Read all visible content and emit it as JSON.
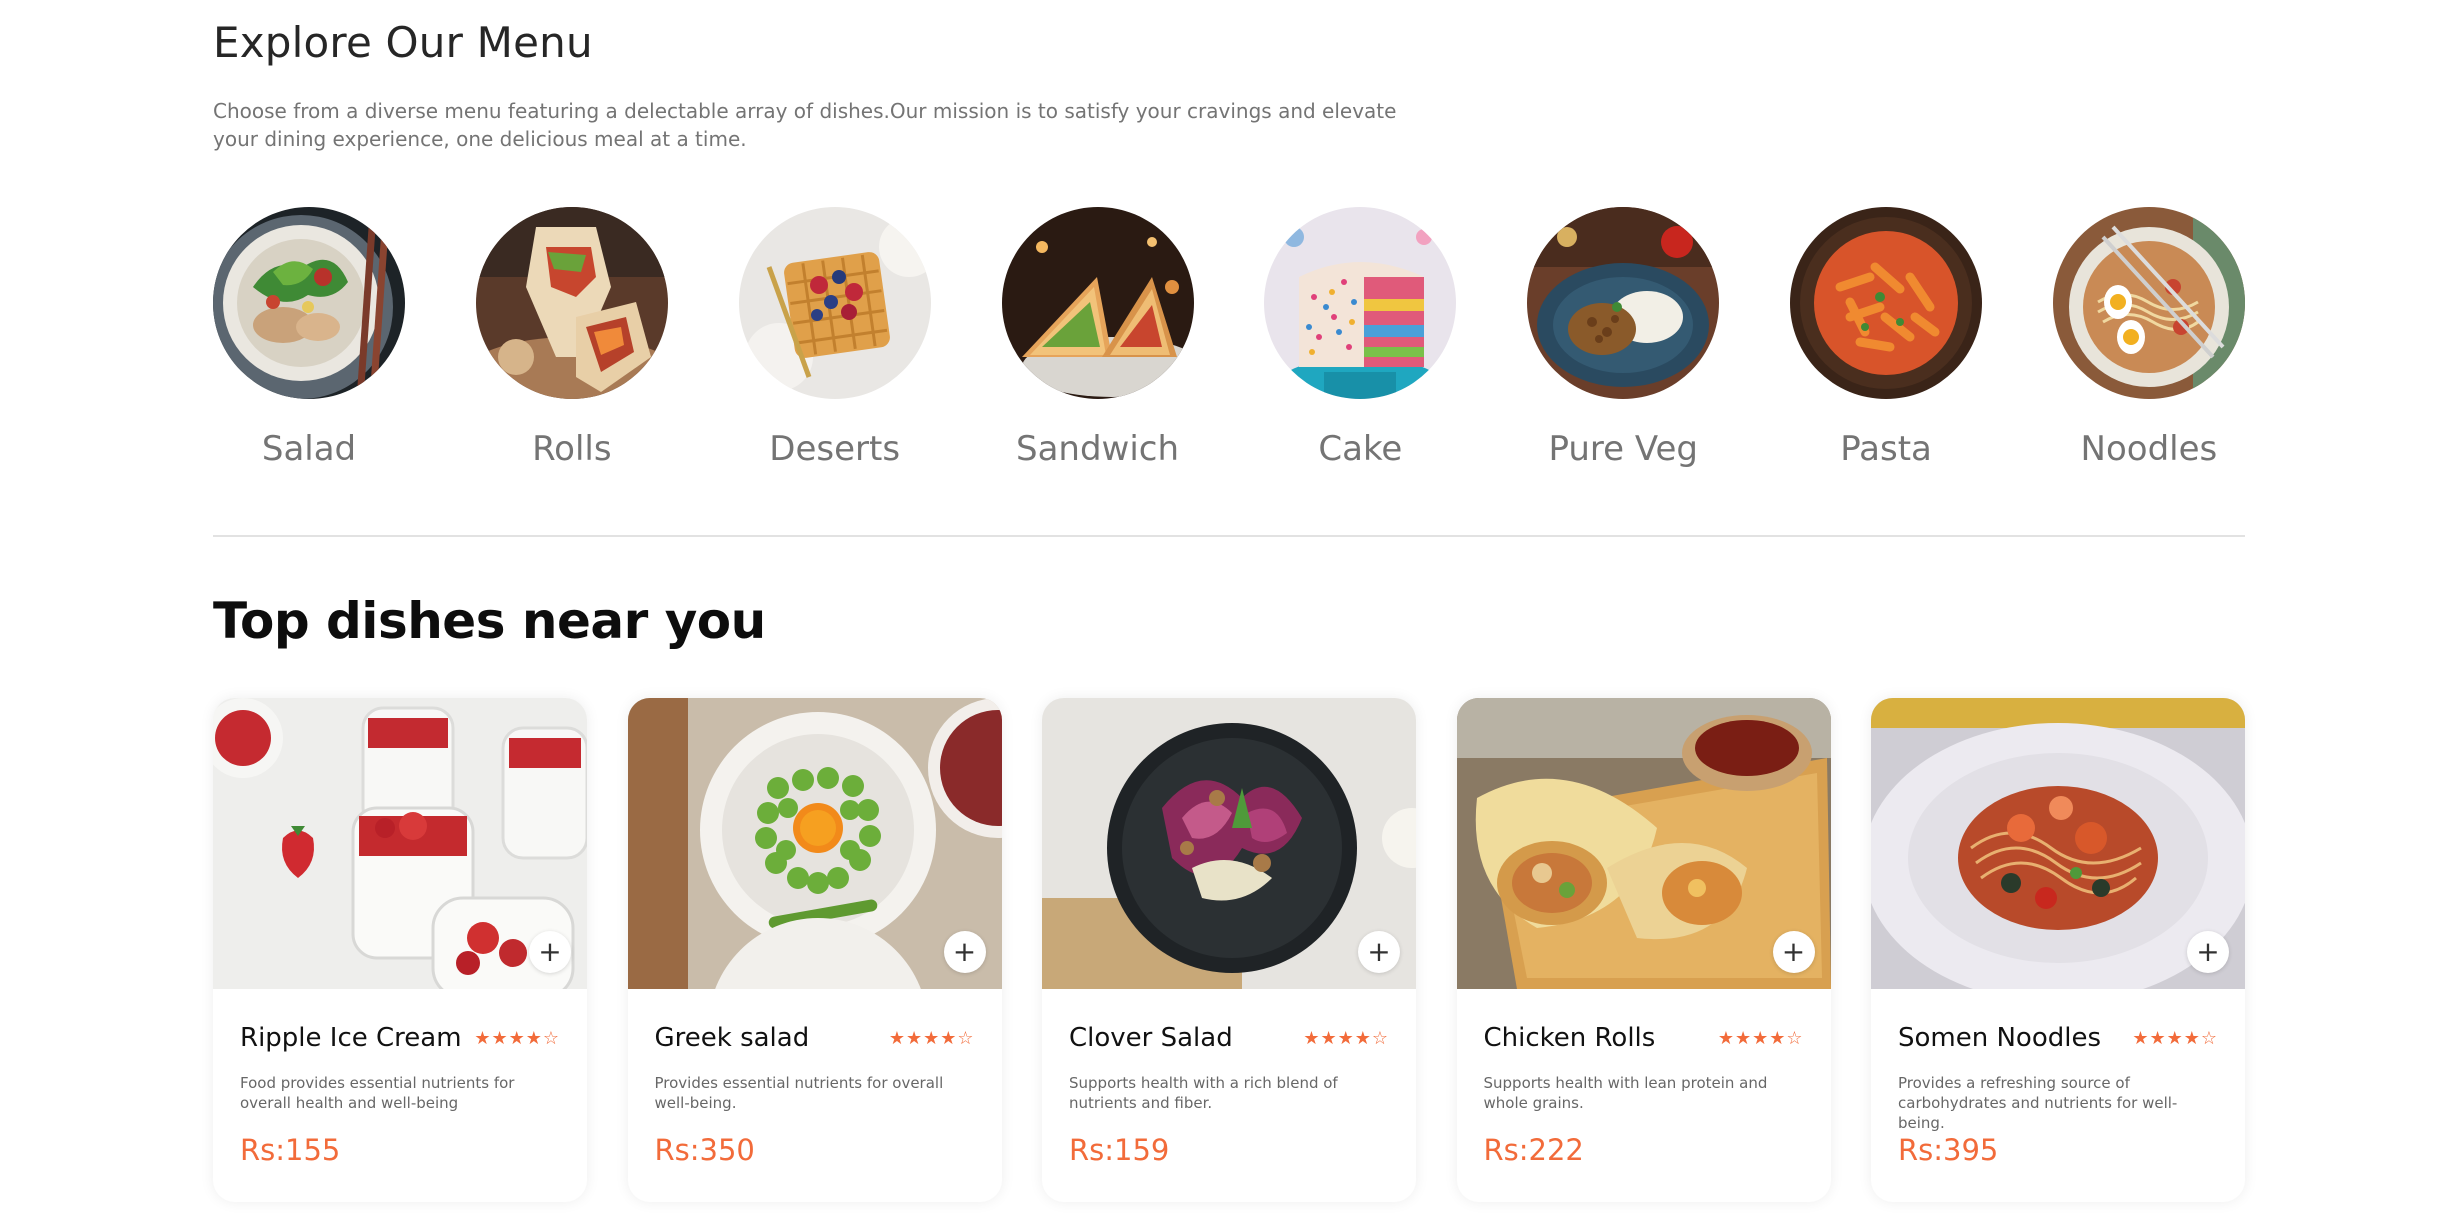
{
  "explore": {
    "title": "Explore Our Menu",
    "description": "Choose from a diverse menu featuring a delectable array of dishes.Our mission is to satisfy your cravings and elevate your dining experience, one delicious meal at a time."
  },
  "categories": [
    {
      "label": "Salad",
      "icon": "salad-image"
    },
    {
      "label": "Rolls",
      "icon": "rolls-image"
    },
    {
      "label": "Deserts",
      "icon": "deserts-image"
    },
    {
      "label": "Sandwich",
      "icon": "sandwich-image"
    },
    {
      "label": "Cake",
      "icon": "cake-image"
    },
    {
      "label": "Pure Veg",
      "icon": "pure-veg-image"
    },
    {
      "label": "Pasta",
      "icon": "pasta-image"
    },
    {
      "label": "Noodles",
      "icon": "noodles-image"
    }
  ],
  "top_dishes": {
    "title": "Top dishes near you",
    "add_label": "+",
    "items": [
      {
        "name": "Ripple Ice Cream",
        "rating": "★★★★☆",
        "rating_value": 4,
        "description": "Food provides essential nutrients for overall health and well-being",
        "price": "Rs:155"
      },
      {
        "name": "Greek salad",
        "rating": "★★★★☆",
        "rating_value": 4,
        "description": "Provides essential nutrients for overall well-being.",
        "price": "Rs:350"
      },
      {
        "name": "Clover Salad",
        "rating": "★★★★☆",
        "rating_value": 4,
        "description": "Supports health with a rich blend of nutrients and fiber.",
        "price": "Rs:159"
      },
      {
        "name": "Chicken Rolls",
        "rating": "★★★★☆",
        "rating_value": 4,
        "description": "Supports health with lean protein and whole grains.",
        "price": "Rs:222"
      },
      {
        "name": "Somen Noodles",
        "rating": "★★★★☆",
        "rating_value": 4,
        "description": "Provides a refreshing source of carbohydrates and nutrients for well-being.",
        "price": "Rs:395"
      }
    ]
  },
  "colors": {
    "accent": "#f26b3a",
    "heading": "#262626",
    "muted": "#747474",
    "divider": "#e2e2e2"
  }
}
